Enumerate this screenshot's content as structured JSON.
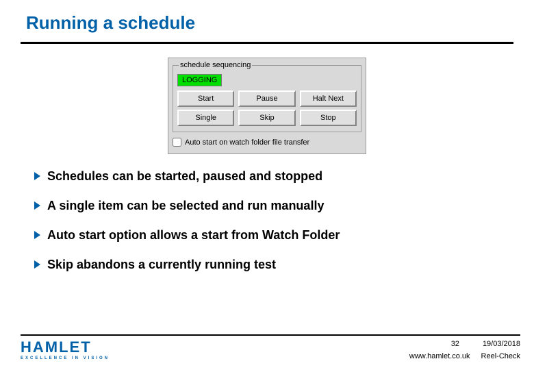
{
  "title": "Running a schedule",
  "panel": {
    "legend": "schedule sequencing",
    "status": "LOGGING",
    "buttons": {
      "start": "Start",
      "pause": "Pause",
      "haltNext": "Halt Next",
      "single": "Single",
      "skip": "Skip",
      "stop": "Stop"
    },
    "checkboxLabel": "Auto start on watch folder file transfer"
  },
  "bullets": [
    "Schedules can be started, paused and stopped",
    "A single item can be selected and run manually",
    "Auto start option allows a start from Watch Folder",
    "Skip abandons a currently running test"
  ],
  "footer": {
    "pageNumber": "32",
    "date": "19/03/2018",
    "url": "www.hamlet.co.uk",
    "product": "Reel-Check",
    "logoMain": "HAMLET",
    "logoSub": "EXCELLENCE IN VISION"
  }
}
